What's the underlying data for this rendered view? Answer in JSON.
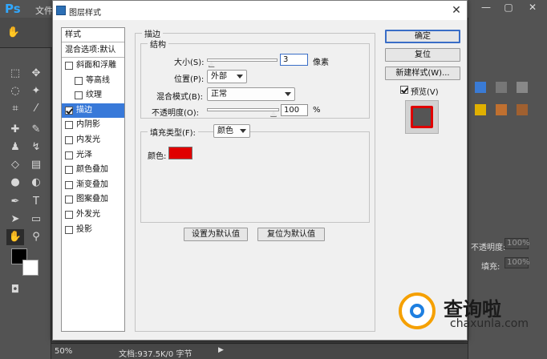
{
  "app": {
    "logo": "Ps",
    "menu_file": "文件",
    "zoom": "50%",
    "doc_info": "文档:937.5K/0 字节"
  },
  "right_panel": {
    "opacity_label": "不透明度:",
    "opacity_value": "100%",
    "fill_label": "填充:",
    "fill_value": "100%"
  },
  "dialog": {
    "title": "图层样式",
    "close": "✕",
    "style_list": {
      "header": "样式",
      "blend_options": "混合选项:默认",
      "items": [
        {
          "label": "斜面和浮雕",
          "checked": false,
          "indent": false,
          "selected": false
        },
        {
          "label": "等高线",
          "checked": false,
          "indent": true,
          "selected": false
        },
        {
          "label": "纹理",
          "checked": false,
          "indent": true,
          "selected": false
        },
        {
          "label": "描边",
          "checked": true,
          "indent": false,
          "selected": true
        },
        {
          "label": "内阴影",
          "checked": false,
          "indent": false,
          "selected": false
        },
        {
          "label": "内发光",
          "checked": false,
          "indent": false,
          "selected": false
        },
        {
          "label": "光泽",
          "checked": false,
          "indent": false,
          "selected": false
        },
        {
          "label": "颜色叠加",
          "checked": false,
          "indent": false,
          "selected": false
        },
        {
          "label": "渐变叠加",
          "checked": false,
          "indent": false,
          "selected": false
        },
        {
          "label": "图案叠加",
          "checked": false,
          "indent": false,
          "selected": false
        },
        {
          "label": "外发光",
          "checked": false,
          "indent": false,
          "selected": false
        },
        {
          "label": "投影",
          "checked": false,
          "indent": false,
          "selected": false
        }
      ]
    },
    "stroke": {
      "section_title": "描边",
      "structure_title": "结构",
      "size_label": "大小(S):",
      "size_value": "3",
      "size_unit": "像素",
      "size_fraction": 0.02,
      "position_label": "位置(P):",
      "position_value": "外部",
      "blend_label": "混合模式(B):",
      "blend_value": "正常",
      "opacity_label": "不透明度(O):",
      "opacity_value": "100",
      "opacity_unit": "%",
      "opacity_fraction": 1.0,
      "fill_type_label": "填充类型(F):",
      "fill_type_value": "颜色",
      "color_label": "颜色:",
      "color": "#e00000"
    },
    "buttons": {
      "ok": "确定",
      "reset": "复位",
      "new_style": "新建样式(W)...",
      "preview": "预览(V)",
      "preview_checked": true,
      "make_default": "设置为默认值",
      "reset_default": "复位为默认值"
    }
  },
  "watermark": {
    "text": "查询啦",
    "url": "chaxunla.com"
  }
}
